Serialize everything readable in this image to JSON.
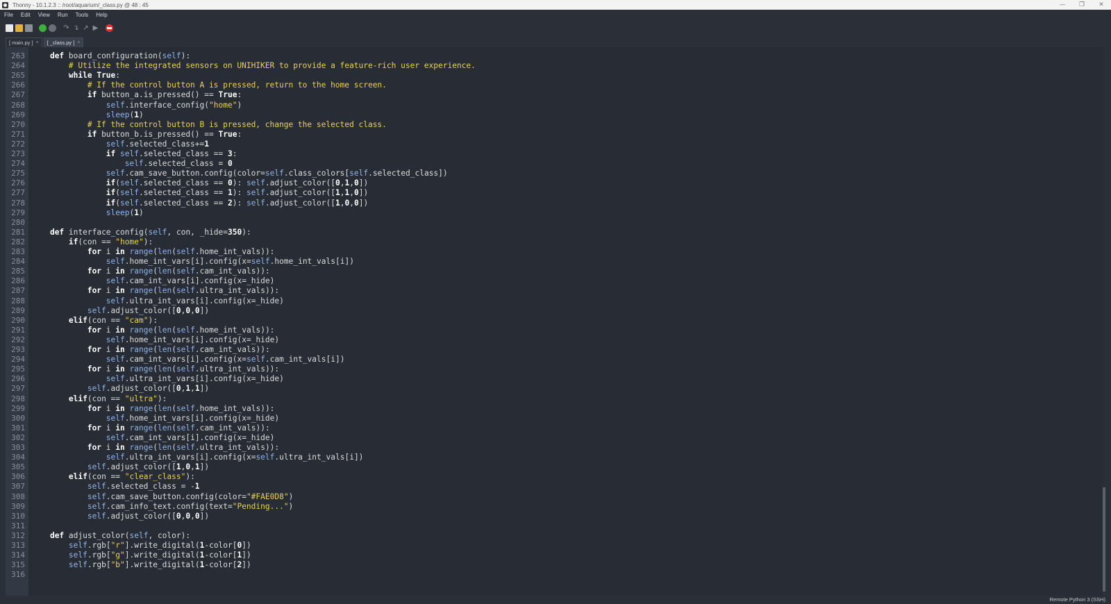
{
  "window": {
    "title": "Thonny  -  10.1.2.3 :: /root/aquarium/_class.py  @  48 : 45",
    "minimize_label": "—",
    "restore_label": "❐",
    "close_label": "✕"
  },
  "menu": {
    "items": [
      "File",
      "Edit",
      "View",
      "Run",
      "Tools",
      "Help"
    ]
  },
  "toolbar": {
    "icons": [
      "new-file-icon",
      "open-file-icon",
      "save-file-icon",
      "run-icon",
      "debug-icon",
      "step-over-icon",
      "step-into-icon",
      "step-out-icon",
      "resume-icon",
      "stop-icon"
    ]
  },
  "tabs": [
    {
      "label": "[ main.py ]",
      "close": "×",
      "active": false
    },
    {
      "label": "[ _class.py ]",
      "close": "×",
      "active": true
    }
  ],
  "editor": {
    "lines": [
      {
        "n": "263",
        "t": "    def board_configuration(self):"
      },
      {
        "n": "264",
        "t": "        # Utilize the integrated sensors on UNIHIKER to provide a feature-rich user experience."
      },
      {
        "n": "265",
        "t": "        while True:"
      },
      {
        "n": "266",
        "t": "            # If the control button A is pressed, return to the home screen."
      },
      {
        "n": "267",
        "t": "            if button_a.is_pressed() == True:"
      },
      {
        "n": "268",
        "t": "                self.interface_config(\"home\")"
      },
      {
        "n": "269",
        "t": "                sleep(1)"
      },
      {
        "n": "270",
        "t": "            # If the control button B is pressed, change the selected class."
      },
      {
        "n": "271",
        "t": "            if button_b.is_pressed() == True:"
      },
      {
        "n": "272",
        "t": "                self.selected_class+=1"
      },
      {
        "n": "273",
        "t": "                if self.selected_class == 3:"
      },
      {
        "n": "274",
        "t": "                    self.selected_class = 0"
      },
      {
        "n": "275",
        "t": "                self.cam_save_button.config(color=self.class_colors[self.selected_class])"
      },
      {
        "n": "276",
        "t": "                if(self.selected_class == 0): self.adjust_color([0,1,0])"
      },
      {
        "n": "277",
        "t": "                if(self.selected_class == 1): self.adjust_color([1,1,0])"
      },
      {
        "n": "278",
        "t": "                if(self.selected_class == 2): self.adjust_color([1,0,0])"
      },
      {
        "n": "279",
        "t": "                sleep(1)"
      },
      {
        "n": "280",
        "t": ""
      },
      {
        "n": "281",
        "t": "    def interface_config(self, con, _hide=350):"
      },
      {
        "n": "282",
        "t": "        if(con == \"home\"):"
      },
      {
        "n": "283",
        "t": "            for i in range(len(self.home_int_vals)):"
      },
      {
        "n": "284",
        "t": "                self.home_int_vars[i].config(x=self.home_int_vals[i])"
      },
      {
        "n": "285",
        "t": "            for i in range(len(self.cam_int_vals)):"
      },
      {
        "n": "286",
        "t": "                self.cam_int_vars[i].config(x=_hide)"
      },
      {
        "n": "287",
        "t": "            for i in range(len(self.ultra_int_vals)):"
      },
      {
        "n": "288",
        "t": "                self.ultra_int_vars[i].config(x=_hide)"
      },
      {
        "n": "289",
        "t": "            self.adjust_color([0,0,0])"
      },
      {
        "n": "290",
        "t": "        elif(con == \"cam\"):"
      },
      {
        "n": "291",
        "t": "            for i in range(len(self.home_int_vals)):"
      },
      {
        "n": "292",
        "t": "                self.home_int_vars[i].config(x=_hide)"
      },
      {
        "n": "293",
        "t": "            for i in range(len(self.cam_int_vals)):"
      },
      {
        "n": "294",
        "t": "                self.cam_int_vars[i].config(x=self.cam_int_vals[i])"
      },
      {
        "n": "295",
        "t": "            for i in range(len(self.ultra_int_vals)):"
      },
      {
        "n": "296",
        "t": "                self.ultra_int_vars[i].config(x=_hide)"
      },
      {
        "n": "297",
        "t": "            self.adjust_color([0,1,1])"
      },
      {
        "n": "298",
        "t": "        elif(con == \"ultra\"):"
      },
      {
        "n": "299",
        "t": "            for i in range(len(self.home_int_vals)):"
      },
      {
        "n": "300",
        "t": "                self.home_int_vars[i].config(x=_hide)"
      },
      {
        "n": "301",
        "t": "            for i in range(len(self.cam_int_vals)):"
      },
      {
        "n": "302",
        "t": "                self.cam_int_vars[i].config(x=_hide)"
      },
      {
        "n": "303",
        "t": "            for i in range(len(self.ultra_int_vals)):"
      },
      {
        "n": "304",
        "t": "                self.ultra_int_vars[i].config(x=self.ultra_int_vals[i])"
      },
      {
        "n": "305",
        "t": "            self.adjust_color([1,0,1])"
      },
      {
        "n": "306",
        "t": "        elif(con == \"clear_class\"):"
      },
      {
        "n": "307",
        "t": "            self.selected_class = -1"
      },
      {
        "n": "308",
        "t": "            self.cam_save_button.config(color=\"#FAE0D8\")"
      },
      {
        "n": "309",
        "t": "            self.cam_info_text.config(text=\"Pending...\")"
      },
      {
        "n": "310",
        "t": "            self.adjust_color([0,0,0])"
      },
      {
        "n": "311",
        "t": ""
      },
      {
        "n": "312",
        "t": "    def adjust_color(self, color):"
      },
      {
        "n": "313",
        "t": "        self.rgb[\"r\"].write_digital(1-color[0])"
      },
      {
        "n": "314",
        "t": "        self.rgb[\"g\"].write_digital(1-color[1])"
      },
      {
        "n": "315",
        "t": "        self.rgb[\"b\"].write_digital(1-color[2])"
      },
      {
        "n": "316",
        "t": ""
      }
    ]
  },
  "status": {
    "interpreter": "Remote Python 3 (SSH)"
  },
  "colors": {
    "background": "#282c35",
    "gutter": "#323844",
    "comment": "#e8d25a",
    "self": "#8fb4e8"
  }
}
